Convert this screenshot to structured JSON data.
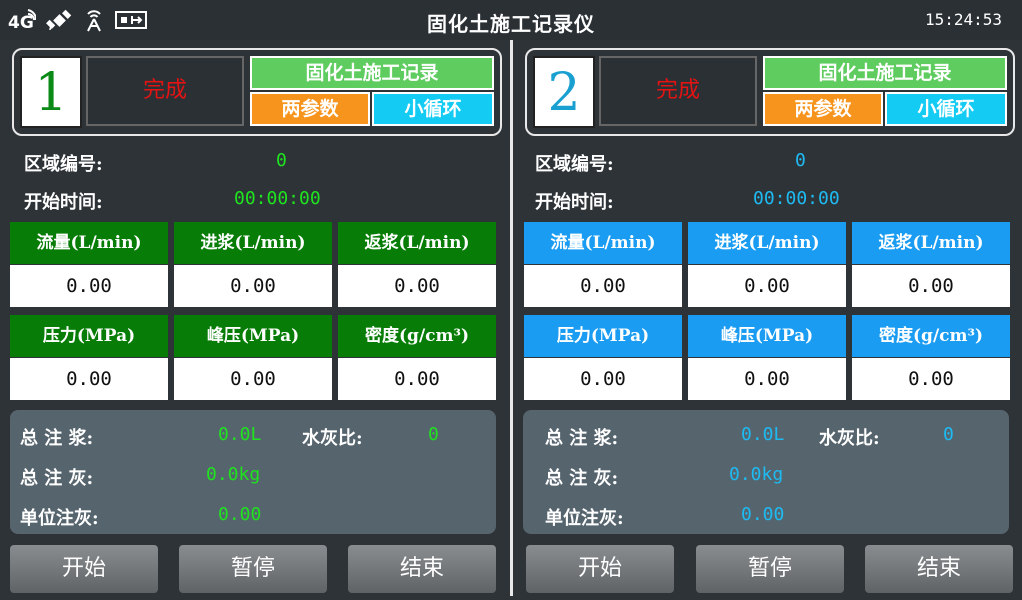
{
  "app": {
    "title": "固化土施工记录仪",
    "clock": "15:24:53"
  },
  "status_icons": [
    "4g-signal-icon",
    "satellite-icon",
    "wifi-tower-icon",
    "usb-device-icon"
  ],
  "colors": {
    "green_accent": "#1ee31e",
    "blue_accent": "#1ebbf2",
    "header_green": "#077d07",
    "header_blue": "#1a9cf2",
    "status_red": "#e31313"
  },
  "panels": [
    {
      "number": "1",
      "status": "完成",
      "mode": "固化土施工记录",
      "params": "两参数",
      "loop": "小循环",
      "area_label": "区域编号:",
      "area_value": "0",
      "start_label": "开始时间:",
      "start_value": "00:00:00",
      "flow_label": "流量(L/min)",
      "flow_value": "0.00",
      "inlet_label": "进浆(L/min)",
      "inlet_value": "0.00",
      "return_label": "返浆(L/min)",
      "return_value": "0.00",
      "pressure_label": "压力(MPa)",
      "pressure_value": "0.00",
      "peak_label": "峰压(MPa)",
      "peak_value": "0.00",
      "density_label": "密度(g/cm³)",
      "density_value": "0.00",
      "total_slurry_label": "总 注 浆:",
      "total_slurry_value": "0.0L",
      "wc_ratio_label": "水灰比:",
      "wc_ratio_value": "0",
      "total_ash_label": "总 注 灰:",
      "total_ash_value": "0.0kg",
      "unit_ash_label": "单位注灰:",
      "unit_ash_value": "0.00",
      "start_button": "开始",
      "pause_button": "暂停",
      "end_button": "结束"
    },
    {
      "number": "2",
      "status": "完成",
      "mode": "固化土施工记录",
      "params": "两参数",
      "loop": "小循环",
      "area_label": "区域编号:",
      "area_value": "0",
      "start_label": "开始时间:",
      "start_value": "00:00:00",
      "flow_label": "流量(L/min)",
      "flow_value": "0.00",
      "inlet_label": "进浆(L/min)",
      "inlet_value": "0.00",
      "return_label": "返浆(L/min)",
      "return_value": "0.00",
      "pressure_label": "压力(MPa)",
      "pressure_value": "0.00",
      "peak_label": "峰压(MPa)",
      "peak_value": "0.00",
      "density_label": "密度(g/cm³)",
      "density_value": "0.00",
      "total_slurry_label": "总 注 浆:",
      "total_slurry_value": "0.0L",
      "wc_ratio_label": "水灰比:",
      "wc_ratio_value": "0",
      "total_ash_label": "总 注 灰:",
      "total_ash_value": "0.0kg",
      "unit_ash_label": "单位注灰:",
      "unit_ash_value": "0.00",
      "start_button": "开始",
      "pause_button": "暂停",
      "end_button": "结束"
    }
  ]
}
